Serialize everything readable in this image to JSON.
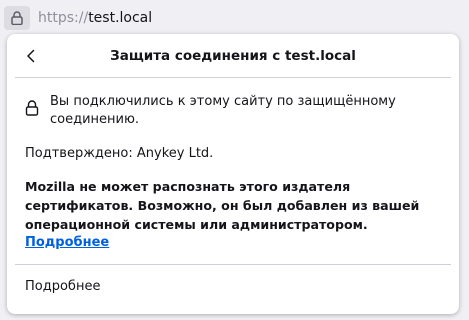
{
  "urlbar": {
    "scheme": "https://",
    "host": "test.local"
  },
  "panel": {
    "title": "Защита соединения с test.local",
    "secure_text": "Вы подключились к этому сайту по защищённому соединению.",
    "verified_text": "Подтверждено: Anykey Ltd.",
    "warning_text": "Mozilla не может распознать этого издателя сертификатов. Возможно, он был добавлен из вашей операционной системы или администратором.",
    "learn_more_link": "Подробнее",
    "more_info_button": "Подробнее"
  },
  "icons": {
    "site_identity": "lock-icon",
    "back": "chevron-left-icon",
    "connection": "lock-icon"
  },
  "colors": {
    "link": "#0061e0",
    "chrome_bg": "#f0f0f4",
    "panel_bg": "#ffffff"
  }
}
